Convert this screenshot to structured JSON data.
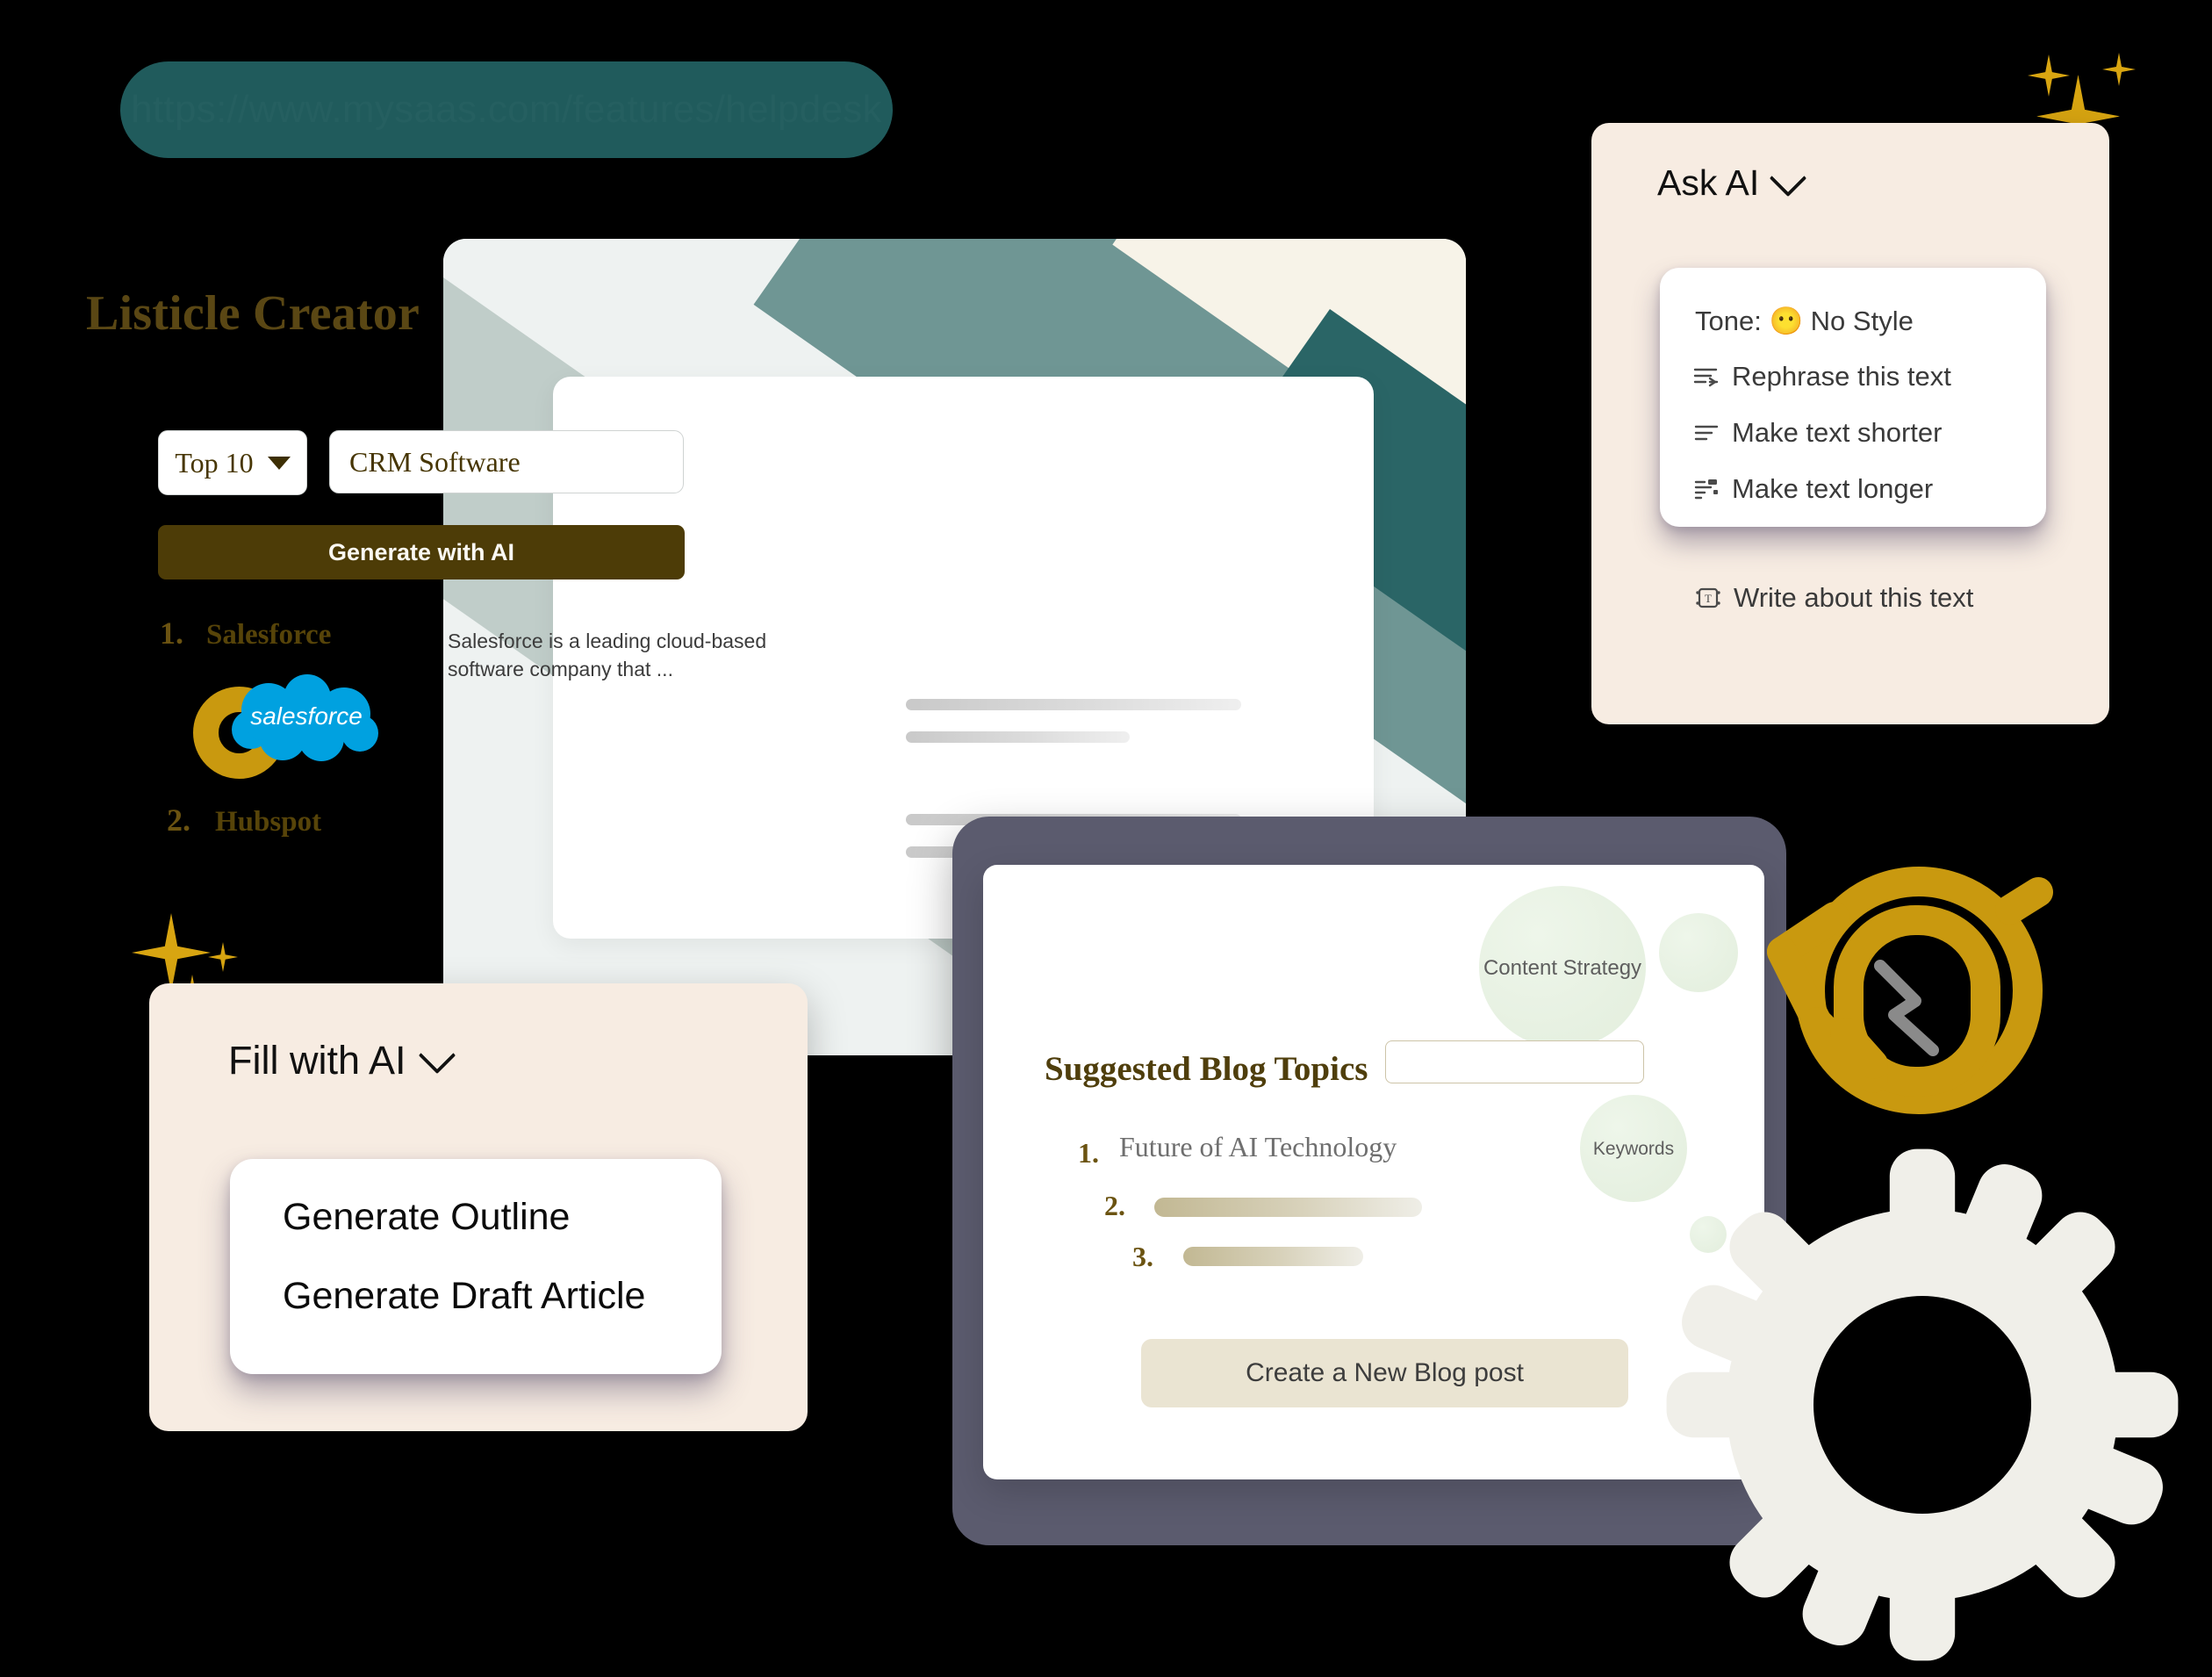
{
  "url_pill": {
    "text": "https://www.mysaas.com/features/helpdesk"
  },
  "listicle": {
    "title": "Listicle Creator",
    "count_select": {
      "value": "Top 10",
      "caret_icon": "chevron-down-icon"
    },
    "topic_input": {
      "value": "CRM Software",
      "placeholder": "CRM Software"
    },
    "generate_label": "Generate with AI",
    "items": [
      {
        "number": "1.",
        "name": "Salesforce",
        "logo_icon": "salesforce-cloud-logo",
        "description": "Salesforce is a leading cloud-based software company that ..."
      },
      {
        "number": "2.",
        "name": "Hubspot",
        "description": ""
      }
    ]
  },
  "ask_ai": {
    "title": "Ask AI",
    "chevron_icon": "chevron-down-icon",
    "items": [
      {
        "label": "Tone: 😶 No Style",
        "icon": "tone-face-icon"
      },
      {
        "label": "Rephrase this text",
        "icon": "rephrase-icon"
      },
      {
        "label": "Make text shorter",
        "icon": "shorten-icon"
      },
      {
        "label": "Make text longer",
        "icon": "lengthen-icon"
      },
      {
        "label": "Write about this text",
        "icon": "write-text-icon"
      }
    ]
  },
  "fill_with_ai": {
    "title": "Fill with AI",
    "chevron_icon": "chevron-down-icon",
    "options": [
      "Generate Outline",
      "Generate Draft Article"
    ]
  },
  "blog_panel": {
    "title": "Suggested Blog Topics",
    "search_value": "",
    "bubbles": [
      "Content Strategy",
      "Keywords"
    ],
    "topics": [
      {
        "number": "1.",
        "label": "Future of AI Technology"
      },
      {
        "number": "2.",
        "label": ""
      },
      {
        "number": "3.",
        "label": ""
      }
    ],
    "cta_label": "Create a New Blog post"
  },
  "decor": {
    "gold_ring": "ring-icon",
    "sparkles": "sparkle-icon",
    "gear": "gear-icon",
    "gold_glyph": "gold-badge-icon"
  },
  "colors": {
    "teal": "#205b5c",
    "gold": "#c9990f",
    "olive": "#4d3c07",
    "cream": "#f7ece2",
    "salesforce_blue": "#00a1e0",
    "tablet_gray": "#5b5b6e",
    "cta_beige": "#eae4d2"
  }
}
